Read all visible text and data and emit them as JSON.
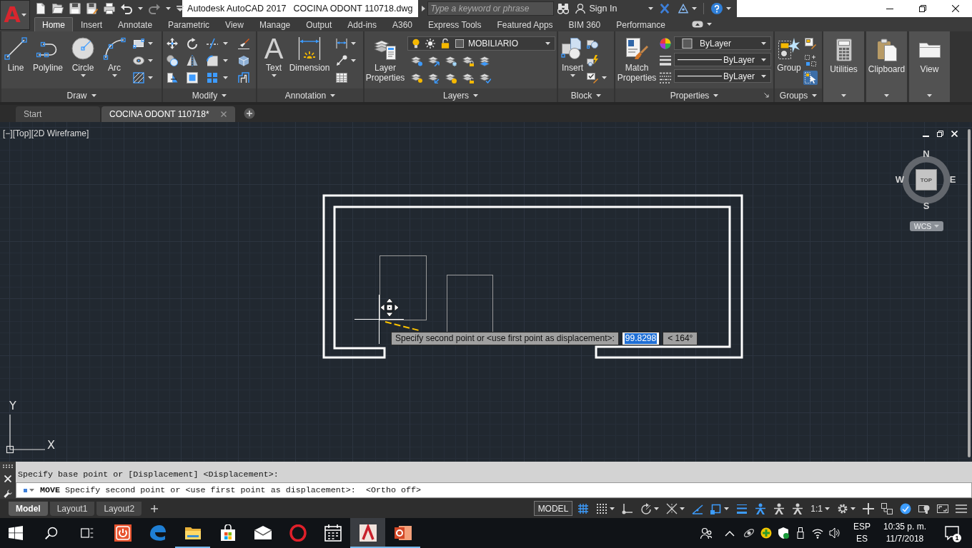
{
  "app_menu": {
    "logo": "A"
  },
  "title_bar": {
    "app_name": "Autodesk AutoCAD 2017",
    "file_name": "COCINA ODONT 110718.dwg"
  },
  "infocenter": {
    "search": {
      "placeholder": "Type a keyword or phrase"
    },
    "sign_in": "Sign In"
  },
  "ribbon_tabs": [
    {
      "label": "Home",
      "selected": true
    },
    {
      "label": "Insert",
      "selected": false
    },
    {
      "label": "Annotate",
      "selected": false
    },
    {
      "label": "Parametric",
      "selected": false
    },
    {
      "label": "View",
      "selected": false
    },
    {
      "label": "Manage",
      "selected": false
    },
    {
      "label": "Output",
      "selected": false
    },
    {
      "label": "Add-ins",
      "selected": false
    },
    {
      "label": "A360",
      "selected": false
    },
    {
      "label": "Express Tools",
      "selected": false
    },
    {
      "label": "Featured Apps",
      "selected": false
    },
    {
      "label": "BIM 360",
      "selected": false
    },
    {
      "label": "Performance",
      "selected": false
    }
  ],
  "ribbon": {
    "draw": {
      "title": "Draw",
      "tools": [
        {
          "label": "Line",
          "menu": false
        },
        {
          "label": "Polyline",
          "menu": false
        },
        {
          "label": "Circle",
          "menu": true
        },
        {
          "label": "Arc",
          "menu": true
        }
      ]
    },
    "modify": {
      "title": "Modify"
    },
    "annotation": {
      "title": "Annotation",
      "text_tool": {
        "glyph": "A",
        "label": "Text",
        "menu": true
      },
      "dimension_tool": {
        "label": "Dimension",
        "menu": false
      }
    },
    "layers": {
      "title": "Layers",
      "tool": {
        "label": "Layer Properties",
        "menu": false
      },
      "current_layer": "MOBILIARIO"
    },
    "block": {
      "title": "Block",
      "tool": {
        "label": "Insert",
        "menu": true
      }
    },
    "properties": {
      "title": "Properties",
      "tool": {
        "label": "Match Properties",
        "menu": false
      },
      "dropdowns": [
        {
          "kind": "color",
          "value": "ByLayer"
        },
        {
          "kind": "linetype",
          "value": "ByLayer"
        },
        {
          "kind": "lineweight",
          "value": "ByLayer"
        }
      ]
    },
    "groups": {
      "title": "Groups",
      "tool": {
        "label": "Group",
        "menu": false
      },
      "pick_style_on": true
    },
    "collapsed_panels": [
      {
        "kind": "utilities",
        "label": "Utilities"
      },
      {
        "kind": "clipboard",
        "label": "Clipboard"
      },
      {
        "kind": "view",
        "label": "View"
      }
    ]
  },
  "file_tabs": [
    {
      "label": "Start",
      "selected": false
    },
    {
      "label": "COCINA ODONT 110718*",
      "selected": true
    }
  ],
  "viewport": {
    "label": "[−][Top][2D Wireframe]"
  },
  "viewcube": {
    "north": "N",
    "east": "E",
    "south": "S",
    "west": "W",
    "face": "TOP",
    "coordinate_system": "WCS"
  },
  "ucs_icon": {
    "x_label": "X",
    "y_label": "Y"
  },
  "dynamic_input": {
    "prompt": "Specify second point or <use first point as displacement>:",
    "distance": {
      "value": "99.8298",
      "selected": true
    },
    "angle": "< 164°"
  },
  "command_line": {
    "history": "Specify base point or [Displacement] <Displacement>:",
    "input": "**MOVE** Specify second point or <use first point as displacement>:  <Ortho off>"
  },
  "layout_tabs": [
    {
      "label": "Model",
      "selected": true
    },
    {
      "label": "Layout1",
      "selected": false
    },
    {
      "label": "Layout2",
      "selected": false
    }
  ],
  "status_bar": {
    "space": "MODEL",
    "toggles": [
      {
        "kind": "grid",
        "on": true,
        "menu": false
      },
      {
        "kind": "snap",
        "on": false,
        "menu": true
      },
      {
        "kind": "constraints",
        "on": false,
        "menu": false
      },
      {
        "kind": "polar",
        "on": false,
        "menu": true
      },
      {
        "kind": "isodraft",
        "on": false,
        "menu": true
      },
      {
        "kind": "tracking",
        "on": true,
        "menu": false
      },
      {
        "kind": "osnap",
        "on": true,
        "menu": true
      },
      {
        "kind": "lineweight",
        "on": true,
        "menu": false
      },
      {
        "kind": "annovisibility",
        "on": true,
        "menu": false
      },
      {
        "kind": "autoscale",
        "on": false,
        "menu": false
      },
      {
        "kind": "annomonitor",
        "on": false,
        "menu": false
      }
    ],
    "annotation_scale": "1:1",
    "tools": [
      {
        "kind": "workspace",
        "on": false,
        "menu": true
      },
      {
        "kind": "plus",
        "on": false,
        "menu": false
      },
      {
        "kind": "quickprops",
        "on": false,
        "menu": false
      },
      {
        "kind": "hardware",
        "on": true,
        "menu": false
      },
      {
        "kind": "isolate",
        "on": false,
        "menu": false
      },
      {
        "kind": "cleanscreen",
        "on": false,
        "menu": false
      },
      {
        "kind": "customize",
        "on": false,
        "menu": false
      }
    ]
  },
  "taskbar": {
    "apps": [
      {
        "kind": "power",
        "running": false,
        "selected": false
      },
      {
        "kind": "browser",
        "running": false,
        "selected": false
      },
      {
        "kind": "folder",
        "running": true,
        "selected": false
      },
      {
        "kind": "store",
        "running": false,
        "selected": false
      },
      {
        "kind": "mail",
        "running": false,
        "selected": false
      },
      {
        "kind": "opera",
        "running": false,
        "selected": false
      },
      {
        "kind": "calendar",
        "running": false,
        "selected": false
      },
      {
        "kind": "cad",
        "running": true,
        "selected": true
      },
      {
        "kind": "slides",
        "running": true,
        "selected": false
      }
    ],
    "tray": {
      "input_language": "ESP",
      "keyboard_layout": "ES",
      "time": "10:35 p. m.",
      "date": "11/7/2018",
      "notification_count": "1"
    }
  }
}
